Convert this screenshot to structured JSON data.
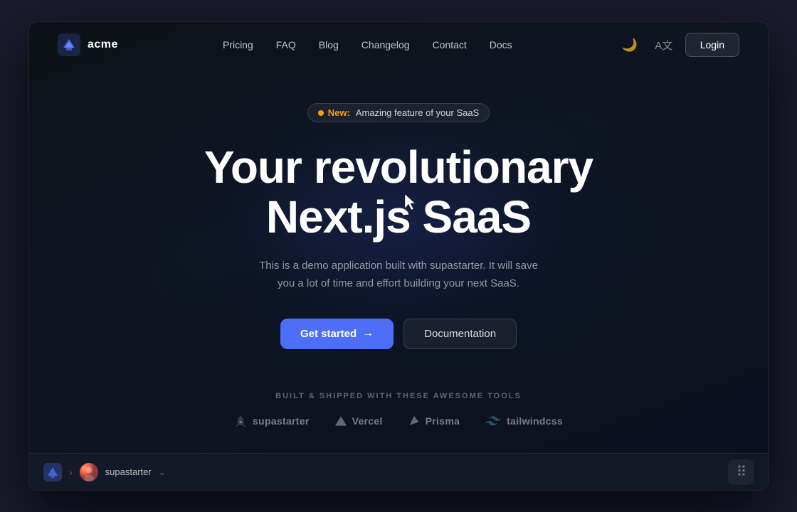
{
  "window": {
    "title": "acme"
  },
  "navbar": {
    "logo_text": "acme",
    "links": [
      {
        "label": "Pricing",
        "id": "pricing"
      },
      {
        "label": "FAQ",
        "id": "faq"
      },
      {
        "label": "Blog",
        "id": "blog"
      },
      {
        "label": "Changelog",
        "id": "changelog"
      },
      {
        "label": "Contact",
        "id": "contact"
      },
      {
        "label": "Docs",
        "id": "docs"
      }
    ],
    "login_label": "Login"
  },
  "hero": {
    "badge_new": "New:",
    "badge_text": "Amazing feature of your SaaS",
    "title_line1": "Your revolutionary",
    "title_line2": "Next.js SaaS",
    "subtitle": "This is a demo application built with supastarter. It will save you a lot of time and effort building your next SaaS.",
    "cta_primary": "Get started",
    "cta_secondary": "Documentation"
  },
  "tools": {
    "label": "BUILT & SHIPPED WITH THESE AWESOME TOOLS",
    "logos": [
      {
        "name": "supastarter",
        "icon": "rocket"
      },
      {
        "name": "Vercel",
        "icon": "triangle"
      },
      {
        "name": "Prisma",
        "icon": "gem"
      },
      {
        "name": "tailwindcss",
        "icon": "wave"
      }
    ]
  },
  "bottom_bar": {
    "user_name": "supastarter",
    "chevron": "↓"
  }
}
